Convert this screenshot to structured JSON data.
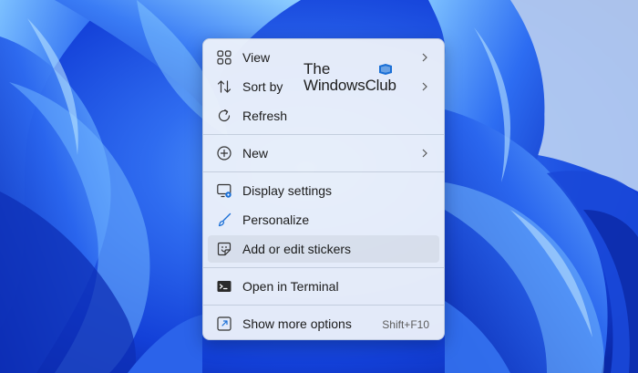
{
  "watermark": {
    "line1": "The",
    "line2": "WindowsClub"
  },
  "colors": {
    "menu_background": "#eef2fa",
    "text": "#1b1b1b",
    "shortcut_text": "#5c5c5c",
    "accent": "#1a6fd6",
    "wallpaper_base": "#1550e0"
  },
  "menu": {
    "items": [
      {
        "label": "View",
        "icon": "view-grid-icon",
        "has_submenu": true
      },
      {
        "label": "Sort by",
        "icon": "sort-arrows-icon",
        "has_submenu": true
      },
      {
        "label": "Refresh",
        "icon": "refresh-icon"
      },
      {
        "label": "New",
        "icon": "plus-circle-icon",
        "has_submenu": true
      },
      {
        "label": "Display settings",
        "icon": "display-settings-icon"
      },
      {
        "label": "Personalize",
        "icon": "brush-icon"
      },
      {
        "label": "Add or edit stickers",
        "icon": "sticker-icon",
        "highlighted": true
      },
      {
        "label": "Open in Terminal",
        "icon": "terminal-icon"
      },
      {
        "label": "Show more options",
        "icon": "show-more-options-icon",
        "shortcut": "Shift+F10"
      }
    ]
  }
}
